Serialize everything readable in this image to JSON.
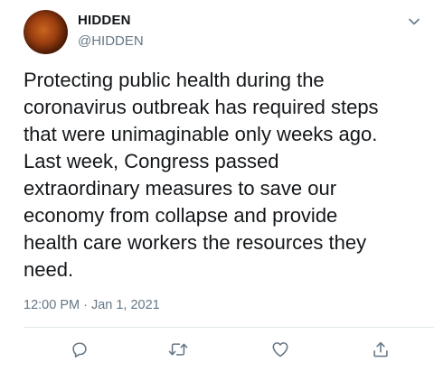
{
  "tweet": {
    "display_name": "HIDDEN",
    "handle": "@HIDDEN",
    "text_lines": [
      "Protecting public health during the",
      "coronavirus outbreak has required steps",
      "that were unimaginable only weeks ago.",
      "Last week, Congress passed",
      "extraordinary measures to save our",
      "economy from collapse and provide",
      "health care workers the resources they",
      "need."
    ],
    "timestamp": "12:00 PM · Jan 1, 2021"
  },
  "icons": {
    "menu": "chevron-down-icon",
    "reply": "reply-icon",
    "retweet": "retweet-icon",
    "like": "heart-icon",
    "share": "share-icon"
  },
  "colors": {
    "text": "#14171a",
    "secondary": "#657786",
    "divider": "#e1e8ed"
  }
}
